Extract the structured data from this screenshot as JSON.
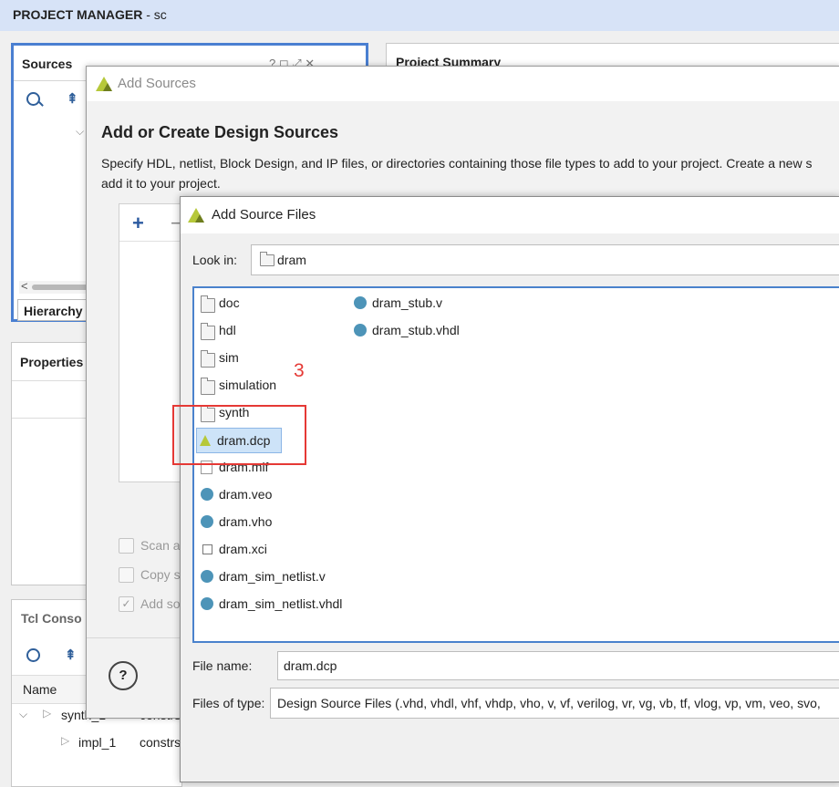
{
  "app": {
    "title_bold": "PROJECT MANAGER",
    "title_rest": " - sc"
  },
  "sources_panel": {
    "title": "Sources",
    "tab_hierarchy": "Hierarchy"
  },
  "project_summary": {
    "title": "Project Summary"
  },
  "properties_panel": {
    "title": "Properties"
  },
  "tcl_panel": {
    "title": "Tcl Conso",
    "col_name": "Name",
    "rows": [
      {
        "name": "synth_1",
        "value": "constrs"
      },
      {
        "name": "impl_1",
        "value": "constrs"
      }
    ]
  },
  "add_sources": {
    "window_title": "Add Sources",
    "heading": "Add or Create Design Sources",
    "description_line1": "Specify HDL, netlist, Block Design, and IP files, or directories containing those file types to add to your project. Create a new s",
    "description_line2": "add it to your project.",
    "add_button": "+",
    "remove_button": "−",
    "options": [
      {
        "label": "Scan a",
        "checked": false
      },
      {
        "label": "Copy s",
        "checked": false
      },
      {
        "label": "Add so",
        "checked": true
      }
    ],
    "help_button": "?"
  },
  "add_source_files": {
    "window_title": "Add Source Files",
    "look_in_label": "Look in:",
    "look_in_value": "dram",
    "files_col1": [
      {
        "name": "doc",
        "type": "folder"
      },
      {
        "name": "hdl",
        "type": "folder"
      },
      {
        "name": "sim",
        "type": "folder"
      },
      {
        "name": "simulation",
        "type": "folder"
      },
      {
        "name": "synth",
        "type": "folder"
      },
      {
        "name": "dram.dcp",
        "type": "vivado",
        "selected": true
      },
      {
        "name": "dram.mif",
        "type": "file"
      },
      {
        "name": "dram.veo",
        "type": "hdl"
      },
      {
        "name": "dram.vho",
        "type": "hdl"
      },
      {
        "name": "dram.xci",
        "type": "ip"
      },
      {
        "name": "dram_sim_netlist.v",
        "type": "hdl"
      },
      {
        "name": "dram_sim_netlist.vhdl",
        "type": "hdl"
      }
    ],
    "files_col2": [
      {
        "name": "dram_stub.v",
        "type": "hdl"
      },
      {
        "name": "dram_stub.vhdl",
        "type": "hdl"
      }
    ],
    "file_name_label": "File name:",
    "file_name_value": "dram.dcp",
    "files_of_type_label": "Files of type:",
    "files_of_type_value": "Design Source Files (.vhd, vhdl, vhf, vhdp, vho, v, vf, verilog, vr, vg, vb, tf, vlog, vp, vm, veo, svo,"
  },
  "annotation": {
    "step_number": "3",
    "color": "#e53935"
  },
  "colors": {
    "selection_border": "#4a82cc",
    "hdl_icon": "#4d94b8",
    "vivado_logo": "#b6c83a"
  }
}
